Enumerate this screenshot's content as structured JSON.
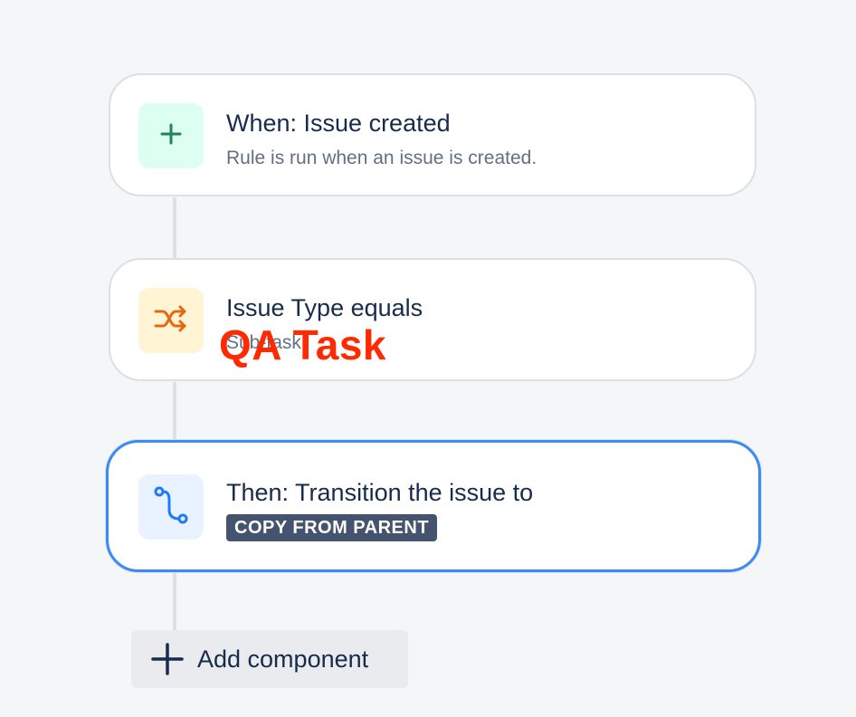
{
  "trigger": {
    "title": "When: Issue created",
    "description": "Rule is run when an issue is created.",
    "icon": "plus-icon",
    "icon_color": "#1f845a",
    "icon_bg": "#dcfff1"
  },
  "condition": {
    "title": "Issue Type equals",
    "description": "Sub-task",
    "icon": "shuffle-icon",
    "icon_color": "#e56910",
    "icon_bg": "#fff4d4"
  },
  "overlay": {
    "text": "QA Task",
    "color": "#ff2a00"
  },
  "action": {
    "title": "Then: Transition the issue to",
    "lozenge": "COPY FROM PARENT",
    "icon": "transition-icon",
    "icon_color": "#1d7afc",
    "icon_bg": "#e9f2ff",
    "selected": true,
    "border_color": "#3d8bf2"
  },
  "add_component": {
    "label": "Add component",
    "icon": "plus-icon"
  }
}
